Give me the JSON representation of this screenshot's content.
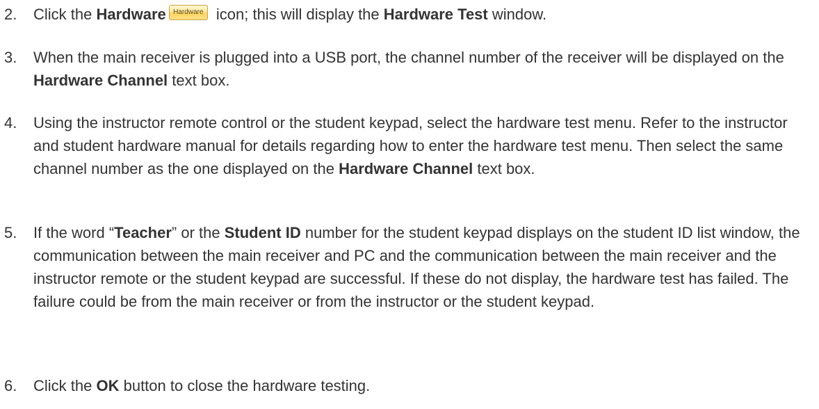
{
  "steps": [
    {
      "number": "2.",
      "parts": [
        "Click the ",
        "Hardware",
        " icon; this will display the ",
        "Hardware Test",
        " window."
      ],
      "icon_label": "Hardware"
    },
    {
      "number": "3.",
      "parts": [
        "When the main receiver is plugged into a USB port, the channel number of the receiver will be displayed on the ",
        "Hardware Channel",
        " text box."
      ]
    },
    {
      "number": "4.",
      "parts": [
        "Using the instructor remote control or the student keypad, select the hardware test menu. Refer to the instructor and student hardware manual for details regarding how to enter the hardware test menu. Then select the same channel number as the one displayed on the ",
        "Hardware Channel",
        " text box."
      ]
    },
    {
      "number": "5.",
      "parts": [
        "If the word “",
        "Teacher",
        "” or the ",
        "Student ID",
        " number for the student keypad displays on the student ID list window, the communication between the main receiver and PC and the communication between the main receiver and the instructor remote or the student keypad are successful. If these do not display, the hardware test has failed. The failure could be from the main receiver or from the instructor or the student keypad."
      ]
    },
    {
      "number": "6.",
      "parts": [
        "Click the ",
        "OK",
        " button to close the hardware testing."
      ]
    }
  ]
}
